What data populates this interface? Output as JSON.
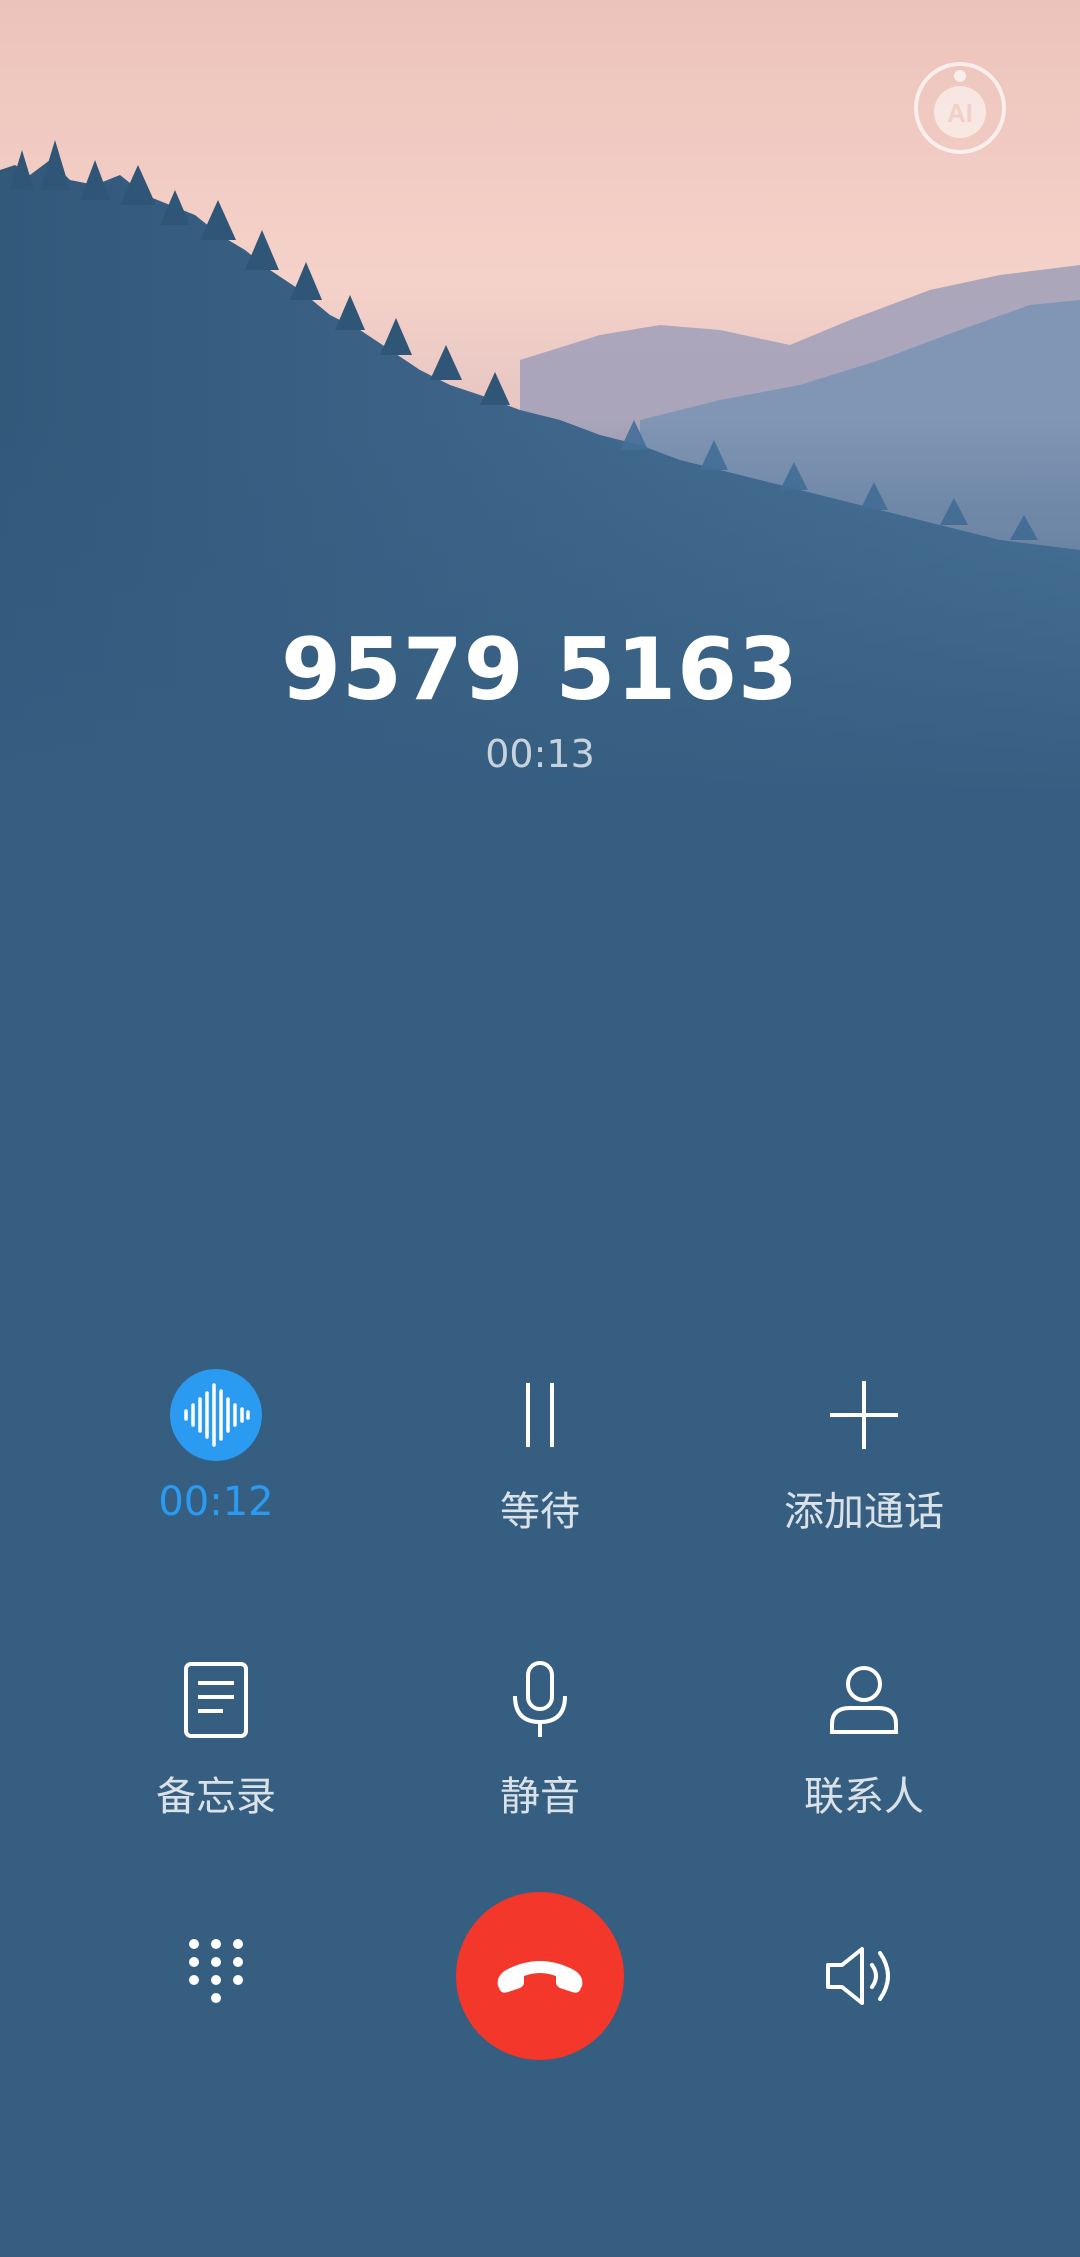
{
  "call": {
    "number": "9579 5163",
    "duration": "00:13"
  },
  "actions": {
    "record": {
      "label": "00:12",
      "icon": "voice-waveform-icon"
    },
    "hold": {
      "label": "等待",
      "icon": "pause-icon"
    },
    "add_call": {
      "label": "添加通话",
      "icon": "plus-icon"
    },
    "notes": {
      "label": "备忘录",
      "icon": "note-icon"
    },
    "mute": {
      "label": "静音",
      "icon": "microphone-icon"
    },
    "contacts": {
      "label": "联系人",
      "icon": "person-icon"
    }
  },
  "bottom": {
    "dialpad": {
      "icon": "dialpad-icon"
    },
    "end_call": {
      "icon": "hang-up-icon"
    },
    "speaker": {
      "icon": "speaker-icon"
    }
  },
  "ai": {
    "label": "AI",
    "icon": "ai-assistant-icon"
  },
  "colors": {
    "background": "#365e81",
    "accent": "#2a9bf0",
    "end_call": "#f3372b"
  }
}
